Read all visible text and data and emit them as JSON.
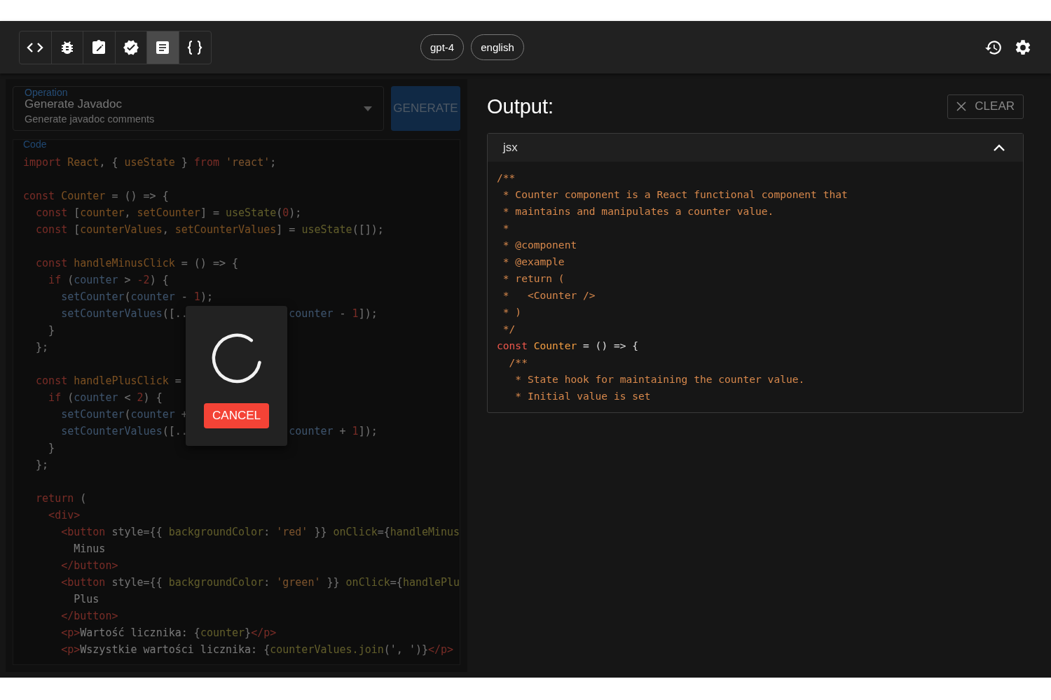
{
  "toolbar": {
    "tools": [
      {
        "kind": "code",
        "selected": false
      },
      {
        "kind": "bug",
        "selected": false
      },
      {
        "kind": "edit",
        "selected": false
      },
      {
        "kind": "verified",
        "selected": false
      },
      {
        "kind": "document",
        "selected": true
      },
      {
        "kind": "braces",
        "selected": false
      }
    ]
  },
  "pills": [
    {
      "text": "gpt-4"
    },
    {
      "text": "english"
    }
  ],
  "operation": {
    "label": "Operation",
    "value": "Generate Javadoc",
    "description": "Generate javadoc comments"
  },
  "generate_button": {
    "label": "GENERATE",
    "disabled": true
  },
  "code": {
    "label": "Code",
    "lines": [
      {
        "kind": "code",
        "tokens": [
          {
            "kind": "keyword",
            "text": "import "
          },
          {
            "kind": "name",
            "text": "React"
          },
          {
            "kind": "plain",
            "text": ", { "
          },
          {
            "kind": "name",
            "text": "useState"
          },
          {
            "kind": "plain",
            "text": " } "
          },
          {
            "kind": "keyword",
            "text": "from "
          },
          {
            "kind": "string",
            "text": "'react'"
          },
          {
            "kind": "plain",
            "text": ";"
          }
        ]
      },
      {
        "kind": "blank"
      },
      {
        "kind": "code",
        "tokens": [
          {
            "kind": "keyword",
            "text": "const "
          },
          {
            "kind": "name",
            "text": "Counter"
          },
          {
            "kind": "plain",
            "text": " = () => {"
          }
        ]
      },
      {
        "kind": "code",
        "tokens": [
          {
            "kind": "keyword",
            "text": "  const"
          },
          {
            "kind": "plain",
            "text": " ["
          },
          {
            "kind": "name",
            "text": "counter"
          },
          {
            "kind": "plain",
            "text": ", "
          },
          {
            "kind": "name",
            "text": "setCounter"
          },
          {
            "kind": "plain",
            "text": "] = "
          },
          {
            "kind": "function",
            "text": "useState"
          },
          {
            "kind": "plain",
            "text": "("
          },
          {
            "kind": "number",
            "text": "0"
          },
          {
            "kind": "plain",
            "text": ");"
          }
        ]
      },
      {
        "kind": "code",
        "tokens": [
          {
            "kind": "keyword",
            "text": "  const"
          },
          {
            "kind": "plain",
            "text": " ["
          },
          {
            "kind": "name",
            "text": "counterValues"
          },
          {
            "kind": "plain",
            "text": ", "
          },
          {
            "kind": "name",
            "text": "setCounterValues"
          },
          {
            "kind": "plain",
            "text": "] = "
          },
          {
            "kind": "function",
            "text": "useState"
          },
          {
            "kind": "plain",
            "text": "([]);"
          }
        ]
      },
      {
        "kind": "blank"
      },
      {
        "kind": "code",
        "tokens": [
          {
            "kind": "keyword",
            "text": "  const "
          },
          {
            "kind": "name",
            "text": "handleMinusClick"
          },
          {
            "kind": "plain",
            "text": " = () => {"
          }
        ]
      },
      {
        "kind": "code",
        "tokens": [
          {
            "kind": "keyword",
            "text": "    if"
          },
          {
            "kind": "plain",
            "text": " ("
          },
          {
            "kind": "variable",
            "text": "counter"
          },
          {
            "kind": "plain",
            "text": " > "
          },
          {
            "kind": "number",
            "text": "-2"
          },
          {
            "kind": "plain",
            "text": ") {"
          }
        ]
      },
      {
        "kind": "code",
        "tokens": [
          {
            "kind": "variable",
            "text": "      setCounter"
          },
          {
            "kind": "plain",
            "text": "("
          },
          {
            "kind": "variable",
            "text": "counter"
          },
          {
            "kind": "plain",
            "text": " - "
          },
          {
            "kind": "number",
            "text": "1"
          },
          {
            "kind": "plain",
            "text": ");"
          }
        ]
      },
      {
        "kind": "split",
        "before": [
          {
            "kind": "variable",
            "text": "      setCounterValues"
          },
          {
            "kind": "plain",
            "text": "([.."
          }
        ],
        "after": [
          {
            "kind": "variable",
            "text": "counter"
          },
          {
            "kind": "plain",
            "text": " - "
          },
          {
            "kind": "number",
            "text": "1"
          },
          {
            "kind": "plain",
            "text": "]);"
          }
        ]
      },
      {
        "kind": "code",
        "tokens": [
          {
            "kind": "plain",
            "text": "    }"
          }
        ]
      },
      {
        "kind": "code",
        "tokens": [
          {
            "kind": "plain",
            "text": "  };"
          }
        ]
      },
      {
        "kind": "blank"
      },
      {
        "kind": "code",
        "tokens": [
          {
            "kind": "keyword",
            "text": "  const "
          },
          {
            "kind": "name",
            "text": "handlePlusClick"
          },
          {
            "kind": "plain",
            "text": " ="
          }
        ]
      },
      {
        "kind": "code",
        "tokens": [
          {
            "kind": "keyword",
            "text": "    if"
          },
          {
            "kind": "plain",
            "text": " ("
          },
          {
            "kind": "variable",
            "text": "counter"
          },
          {
            "kind": "plain",
            "text": " < "
          },
          {
            "kind": "number",
            "text": "2"
          },
          {
            "kind": "plain",
            "text": ") {"
          }
        ]
      },
      {
        "kind": "code",
        "tokens": [
          {
            "kind": "variable",
            "text": "      setCounter"
          },
          {
            "kind": "plain",
            "text": "("
          },
          {
            "kind": "variable",
            "text": "counter"
          },
          {
            "kind": "plain",
            "text": " +"
          }
        ]
      },
      {
        "kind": "split",
        "before": [
          {
            "kind": "variable",
            "text": "      setCounterValues"
          },
          {
            "kind": "plain",
            "text": "([.."
          }
        ],
        "after": [
          {
            "kind": "variable",
            "text": "counter"
          },
          {
            "kind": "plain",
            "text": " + "
          },
          {
            "kind": "number",
            "text": "1"
          },
          {
            "kind": "plain",
            "text": "]);"
          }
        ]
      },
      {
        "kind": "code",
        "tokens": [
          {
            "kind": "plain",
            "text": "    }"
          }
        ]
      },
      {
        "kind": "code",
        "tokens": [
          {
            "kind": "plain",
            "text": "  };"
          }
        ]
      },
      {
        "kind": "blank"
      },
      {
        "kind": "code",
        "tokens": [
          {
            "kind": "keyword",
            "text": "  return"
          },
          {
            "kind": "plain",
            "text": " ("
          }
        ]
      },
      {
        "kind": "code",
        "tokens": [
          {
            "kind": "tag",
            "text": "    <div>"
          }
        ]
      },
      {
        "kind": "code",
        "tokens": [
          {
            "kind": "tag",
            "text": "      <button"
          },
          {
            "kind": "plain",
            "text": " style={{ "
          },
          {
            "kind": "function",
            "text": "backgroundColor"
          },
          {
            "kind": "plain",
            "text": ": "
          },
          {
            "kind": "string",
            "text": "'red'"
          },
          {
            "kind": "plain",
            "text": " }} "
          },
          {
            "kind": "function",
            "text": "onClick"
          },
          {
            "kind": "plain",
            "text": "={"
          },
          {
            "kind": "function",
            "text": "handleMinus"
          }
        ]
      },
      {
        "kind": "code",
        "tokens": [
          {
            "kind": "text",
            "text": "        Minus"
          }
        ]
      },
      {
        "kind": "code",
        "tokens": [
          {
            "kind": "tag",
            "text": "      </button>"
          }
        ]
      },
      {
        "kind": "code",
        "tokens": [
          {
            "kind": "tag",
            "text": "      <button"
          },
          {
            "kind": "plain",
            "text": " style={{ "
          },
          {
            "kind": "function",
            "text": "backgroundColor"
          },
          {
            "kind": "plain",
            "text": ": "
          },
          {
            "kind": "string",
            "text": "'green'"
          },
          {
            "kind": "plain",
            "text": " }} "
          },
          {
            "kind": "function",
            "text": "onClick"
          },
          {
            "kind": "plain",
            "text": "={"
          },
          {
            "kind": "function",
            "text": "handlePlu"
          }
        ]
      },
      {
        "kind": "code",
        "tokens": [
          {
            "kind": "text",
            "text": "        Plus"
          }
        ]
      },
      {
        "kind": "code",
        "tokens": [
          {
            "kind": "tag",
            "text": "      </button>"
          }
        ]
      },
      {
        "kind": "code",
        "tokens": [
          {
            "kind": "tag",
            "text": "      <p>"
          },
          {
            "kind": "text",
            "text": "Wartość licznika: "
          },
          {
            "kind": "plain",
            "text": "{"
          },
          {
            "kind": "function",
            "text": "counter"
          },
          {
            "kind": "plain",
            "text": "}"
          },
          {
            "kind": "tag",
            "text": "</p>"
          }
        ]
      },
      {
        "kind": "code",
        "tokens": [
          {
            "kind": "tag",
            "text": "      <p>"
          },
          {
            "kind": "text",
            "text": "Wszystkie wartości licznika: "
          },
          {
            "kind": "plain",
            "text": "{"
          },
          {
            "kind": "function",
            "text": "counterValues.join"
          },
          {
            "kind": "plain",
            "text": "(', ')}"
          },
          {
            "kind": "tag",
            "text": "</p>"
          }
        ]
      }
    ]
  },
  "loading_dialog": {
    "cancel_button": "CANCEL"
  },
  "output": {
    "title": "Output:",
    "clear_button": "CLEAR",
    "panel": {
      "language": "jsx",
      "expanded": true,
      "lines": [
        {
          "kind": "code",
          "tokens": [
            {
              "kind": "comment",
              "text": "/**"
            }
          ]
        },
        {
          "kind": "code",
          "tokens": [
            {
              "kind": "comment",
              "text": " * Counter component is a React functional component that"
            }
          ]
        },
        {
          "kind": "code",
          "tokens": [
            {
              "kind": "comment",
              "text": " * maintains and manipulates a counter value."
            }
          ]
        },
        {
          "kind": "code",
          "tokens": [
            {
              "kind": "comment",
              "text": " *"
            }
          ]
        },
        {
          "kind": "code",
          "tokens": [
            {
              "kind": "comment",
              "text": " * @component"
            }
          ]
        },
        {
          "kind": "code",
          "tokens": [
            {
              "kind": "comment",
              "text": " * @example"
            }
          ]
        },
        {
          "kind": "code",
          "tokens": [
            {
              "kind": "comment",
              "text": " * return ("
            }
          ]
        },
        {
          "kind": "code",
          "tokens": [
            {
              "kind": "comment",
              "text": " *   <Counter />"
            }
          ]
        },
        {
          "kind": "code",
          "tokens": [
            {
              "kind": "comment",
              "text": " * )"
            }
          ]
        },
        {
          "kind": "code",
          "tokens": [
            {
              "kind": "comment",
              "text": " */"
            }
          ]
        },
        {
          "kind": "code",
          "tokens": [
            {
              "kind": "keyword",
              "text": "const "
            },
            {
              "kind": "name",
              "text": "Counter"
            },
            {
              "kind": "plain",
              "text": " = () => {"
            }
          ]
        },
        {
          "kind": "code",
          "tokens": [
            {
              "kind": "comment",
              "text": "  /**"
            }
          ]
        },
        {
          "kind": "code",
          "tokens": [
            {
              "kind": "comment",
              "text": "   * State hook for maintaining the counter value."
            }
          ]
        },
        {
          "kind": "code",
          "tokens": [
            {
              "kind": "comment",
              "text": "   * Initial value is set"
            }
          ]
        }
      ]
    }
  }
}
